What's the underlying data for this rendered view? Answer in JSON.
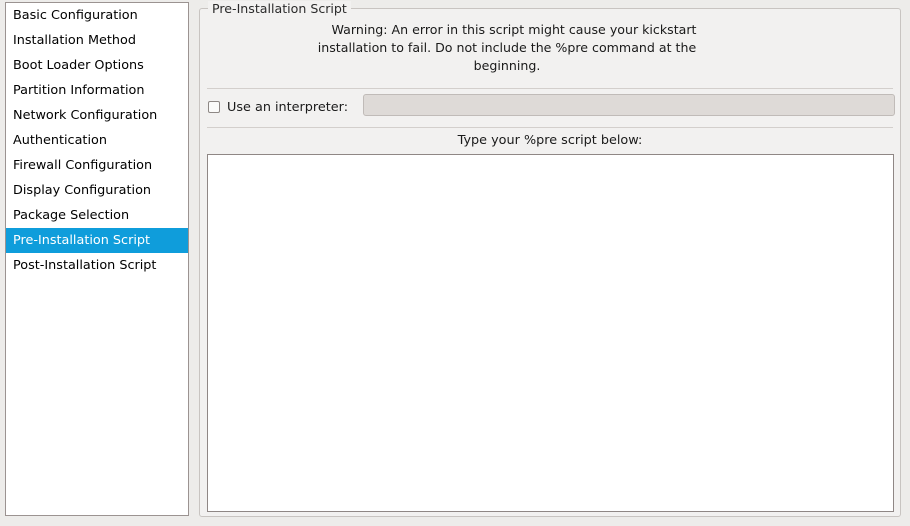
{
  "sidebar": {
    "items": [
      {
        "label": "Basic Configuration",
        "selected": false
      },
      {
        "label": "Installation Method",
        "selected": false
      },
      {
        "label": "Boot Loader Options",
        "selected": false
      },
      {
        "label": "Partition Information",
        "selected": false
      },
      {
        "label": "Network Configuration",
        "selected": false
      },
      {
        "label": "Authentication",
        "selected": false
      },
      {
        "label": "Firewall Configuration",
        "selected": false
      },
      {
        "label": "Display Configuration",
        "selected": false
      },
      {
        "label": "Package Selection",
        "selected": false
      },
      {
        "label": "Pre-Installation Script",
        "selected": true
      },
      {
        "label": "Post-Installation Script",
        "selected": false
      }
    ],
    "selected_index": 9,
    "selection_color": "#0f9ddb",
    "selection_text_color": "#ffffff"
  },
  "panel": {
    "title": "Pre-Installation Script",
    "warning": {
      "line1": "Warning: An error in this script might cause your kickstart",
      "line2": "installation to fail. Do not include the %pre command at the",
      "line3": "beginning."
    },
    "interpreter": {
      "checkbox_label": "Use an interpreter:",
      "checked": false,
      "entry_value": "",
      "entry_placeholder": "",
      "entry_enabled": false
    },
    "script": {
      "label": "Type your %pre script below:",
      "value": ""
    }
  },
  "colors": {
    "window_background": "#edecea",
    "panel_background": "#f2f1f0",
    "field_background": "#ffffff",
    "disabled_field_background": "#dedad7",
    "frame_border": "#c8c4c1",
    "widget_border": "#8f8785"
  }
}
